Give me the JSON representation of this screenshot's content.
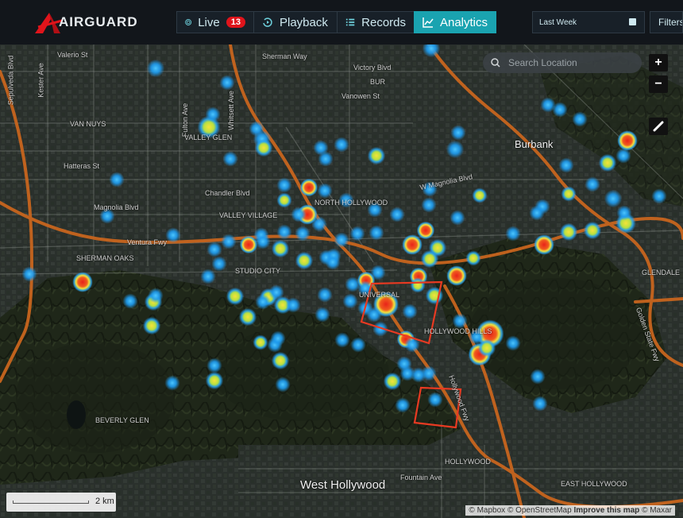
{
  "app": {
    "brand": "AIRGUARD",
    "brand_color": "#e0141b"
  },
  "nav": {
    "live": "Live",
    "live_count": "13",
    "playback": "Playback",
    "records": "Records",
    "analytics": "Analytics",
    "active_tab": "Analytics",
    "accent": "#1aa3b0"
  },
  "filters": {
    "range": "Last Week",
    "filter_label": "Filters"
  },
  "map": {
    "search_placeholder": "Search Location",
    "zoom_in": "+",
    "zoom_out": "−",
    "scale_label": "2 km",
    "attribution": {
      "mapbox": "© Mapbox",
      "osm": "© OpenStreetMap",
      "improve": "Improve this map",
      "maxar": "© Maxar"
    },
    "places": {
      "burbank": "Burbank",
      "west_hollywood": "West Hollywood",
      "valerio": "Valerio St",
      "sherman_way": "Sherman Way",
      "victory_blvd": "Victory Blvd",
      "vanowen": "Vanowen St",
      "van_nuys": "VAN NUYS",
      "valley_glen": "VALLEY GLEN",
      "hatteras": "Hatteras St",
      "chandler": "Chandler Blvd",
      "magnolia_w": "Magnolia Blvd",
      "magnolia_e": "W Magnolia Blvd",
      "valley_village": "VALLEY VILLAGE",
      "north_hollywood": "NORTH HOLLYWOOD",
      "ventura_fwy": "Ventura Fwy",
      "sherman_oaks": "SHERMAN OAKS",
      "studio_city": "STUDIO CITY",
      "universal": "UNIVERSAL",
      "hollywood_hills": "HOLLYWOOD HILLS",
      "beverly_glen": "BEVERLY GLEN",
      "hollywood": "HOLLYWOOD",
      "fountain": "Fountain Ave",
      "east_hollywood": "EAST HOLLYWOOD",
      "glendale": "GLENDALE",
      "bur": "BUR",
      "fulton": "Fulton Ave",
      "whitsett": "Whitsett Ave",
      "kester": "Kester Ave",
      "sepulveda": "Sepulveda Blvd",
      "golden_state": "Golden State Fwy",
      "hollywood_fwy": "Hollywood Fwy"
    },
    "colors": {
      "hot": "#e8231a",
      "warm": "#f4e23a",
      "cool": "#1e9cf0",
      "highway": "#c8651e",
      "zone_outline": "#e83a22"
    }
  }
}
